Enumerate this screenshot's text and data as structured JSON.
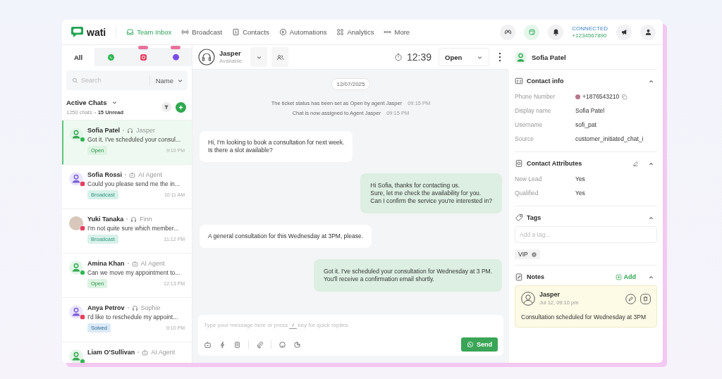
{
  "brand": {
    "name": "wati"
  },
  "nav": [
    {
      "kind": "inbox",
      "label": "Team Inbox",
      "selected": true
    },
    {
      "kind": "broadcast",
      "label": "Broadcast",
      "selected": false
    },
    {
      "kind": "contacts",
      "label": "Contacts",
      "selected": false
    },
    {
      "kind": "automations",
      "label": "Automations",
      "selected": false
    },
    {
      "kind": "analytics",
      "label": "Analytics",
      "selected": false
    },
    {
      "kind": "more",
      "label": "More",
      "selected": false
    }
  ],
  "connection": {
    "status": "CONNECTED",
    "phone": "+1234567890"
  },
  "channel_tabs": [
    {
      "kind": "all",
      "label": "All",
      "selected": true,
      "new_badge": false
    },
    {
      "kind": "whatsapp",
      "selected": false,
      "new_badge": false
    },
    {
      "kind": "instagram",
      "selected": false,
      "new_badge": true
    },
    {
      "kind": "messenger",
      "selected": false,
      "new_badge": true
    }
  ],
  "search": {
    "placeholder": "Search",
    "sort": "Name"
  },
  "chat_list": {
    "title": "Active Chats",
    "count": "1250 chats",
    "unread": "15 Unread",
    "items": [
      {
        "name": "Sofia Patel",
        "agent": {
          "kind": "human",
          "name": "Jasper"
        },
        "preview": "Got it. I've scheduled your consul...",
        "status": "Open",
        "color": "#dcf3e2",
        "time": "9:10 PM",
        "avatar": {
          "kind": "contact"
        },
        "channel": {
          "kind": "whatsapp"
        },
        "selected": true
      },
      {
        "name": "Sofia Rossi",
        "agent": {
          "kind": "ai",
          "name": "AI Agent"
        },
        "preview": "Could you please send me the in...",
        "status": "Broadcast",
        "color": "#d8f1ea",
        "time": "10:11 AM",
        "avatar": {
          "kind": "contact"
        },
        "channel": {
          "kind": "instagram"
        },
        "selected": false
      },
      {
        "name": "Yuki Tanaka",
        "agent": {
          "kind": "human",
          "name": "Finn"
        },
        "preview": "I'm not quite sure which member...",
        "status": "Broadcast",
        "color": "#d8f1ea",
        "time": "11:12 PM",
        "avatar": {
          "kind": "photo"
        },
        "channel": {
          "kind": "instagram"
        },
        "selected": false
      },
      {
        "name": "Amina Khan",
        "agent": {
          "kind": "ai",
          "name": "AI Agent"
        },
        "preview": "Can we move my appointment to...",
        "status": "Open",
        "color": "#dcf3e2",
        "time": "12:13 PM",
        "avatar": {
          "kind": "contact"
        },
        "channel": {
          "kind": "whatsapp"
        },
        "selected": false
      },
      {
        "name": "Anya Petrov",
        "agent": {
          "kind": "human",
          "name": "Sophie"
        },
        "preview": "I'd like to reschedule my appoint...",
        "status": "Solved",
        "color": "#dbeaf7",
        "time": "9:10 PM",
        "avatar": {
          "kind": "contact"
        },
        "channel": {
          "kind": "instagram"
        },
        "selected": false
      },
      {
        "name": "Liam O'Sullivan",
        "agent": {
          "kind": "ai",
          "name": "AI Agent"
        },
        "avatar": {
          "kind": "contact"
        },
        "channel": {
          "kind": "whatsapp"
        },
        "selected": false
      }
    ]
  },
  "chat_header": {
    "agent": "Jasper",
    "availability": "Available",
    "timer": "12:39",
    "ticket_status": "Open"
  },
  "messages": [
    {
      "kind": "date",
      "text": "12/07/2025"
    },
    {
      "kind": "system",
      "text": "The ticket status has been set as Open by agent Jasper",
      "time": "09:15 PM"
    },
    {
      "kind": "system",
      "text": "Chat is now assigned to Agent Jasper",
      "time": "09:15 PM"
    },
    {
      "kind": "incoming",
      "text": "Hi, I'm looking to book a consultation for next week.\nIs there a slot available?"
    },
    {
      "kind": "outgoing",
      "text": "Hi Sofia, thanks for contacting us.\nSure, let me check the availability for you.\nCan I confirm the service you're interested in?"
    },
    {
      "kind": "incoming",
      "text": "A general consultation for this Wednesday at 3PM, please."
    },
    {
      "kind": "outgoing",
      "text": "Got it. I've scheduled your consultation for Wednesday at 3 PM.\nYou'll receive a confirmation email shortly."
    }
  ],
  "composer": {
    "placeholder_start": "Type your message here or press",
    "shortcut_key": "/",
    "placeholder_end": "key for quick replies.",
    "send": "Send"
  },
  "contact": {
    "name": "Sofia Patel"
  },
  "contact_info": {
    "title": "Contact info",
    "expanded": true,
    "fields": [
      {
        "kind": "phone",
        "label": "Phone Number",
        "value": "+1876543210"
      },
      {
        "kind": "text",
        "label": "Display name",
        "value": "Sofia Patel"
      },
      {
        "kind": "text",
        "label": "Username",
        "value": "sofi_pat"
      },
      {
        "kind": "text",
        "label": "Source",
        "value": "customer_initiated_chat_i"
      }
    ]
  },
  "attributes": {
    "title": "Contact Attributes",
    "expanded": true,
    "fields": [
      {
        "label": "New Lead",
        "value": "Yes"
      },
      {
        "label": "Qualified",
        "value": "Yes"
      }
    ]
  },
  "tags": {
    "title": "Tags",
    "expanded": true,
    "placeholder": "Add a tag...",
    "items": [
      "VIP"
    ]
  },
  "notes": {
    "title": "Notes",
    "expanded": true,
    "add_label": "Add",
    "items": [
      {
        "author": "Jasper",
        "date": "Jul 12, 09:10 pm",
        "text": "Consultation scheduled for Wednesday at 3PM"
      }
    ]
  }
}
